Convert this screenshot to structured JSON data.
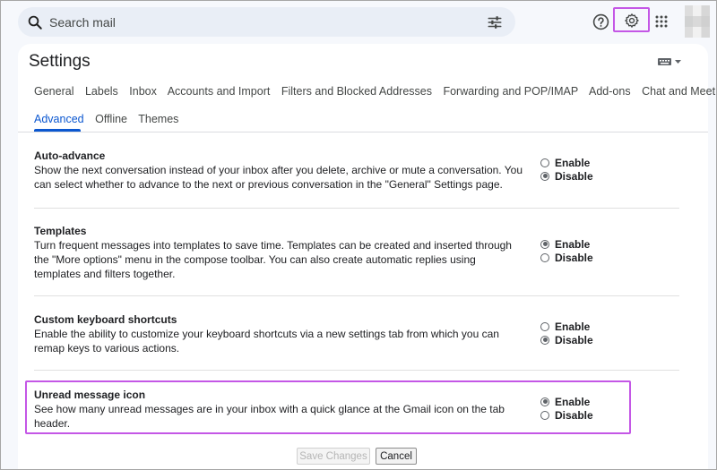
{
  "search": {
    "placeholder": "Search mail",
    "icon": "search-icon",
    "options_icon": "tune-icon"
  },
  "topbar": {
    "help_icon": "help-icon",
    "settings_icon": "gear-icon",
    "apps_icon": "apps-grid-icon",
    "highlight_color": "#c457e6"
  },
  "page": {
    "title": "Settings",
    "input_tools_icon": "keyboard-icon"
  },
  "tabs": {
    "row1": [
      "General",
      "Labels",
      "Inbox",
      "Accounts and Import",
      "Filters and Blocked Addresses",
      "Forwarding and POP/IMAP",
      "Add-ons",
      "Chat and Meet"
    ],
    "row2": [
      "Advanced",
      "Offline",
      "Themes"
    ],
    "active": "Advanced",
    "active_color": "#0b57d0"
  },
  "sections": [
    {
      "title": "Auto-advance",
      "lines": [
        "Show the next conversation instead of your inbox after you delete, archive or mute a conversation. You",
        "can select whether to advance to the next or previous conversation in the \"General\" Settings page."
      ],
      "options": [
        "Enable",
        "Disable"
      ],
      "selected": "Disable"
    },
    {
      "title": "Templates",
      "lines": [
        "Turn frequent messages into templates to save time. Templates can be created and inserted through",
        "the \"More options\" menu in the compose toolbar. You can also create automatic replies using",
        "templates and filters together."
      ],
      "options": [
        "Enable",
        "Disable"
      ],
      "selected": "Enable"
    },
    {
      "title": "Custom keyboard shortcuts",
      "lines": [
        "Enable the ability to customize your keyboard shortcuts via a new settings tab from which you can",
        "remap keys to various actions."
      ],
      "options": [
        "Enable",
        "Disable"
      ],
      "selected": "Disable"
    },
    {
      "title": "Unread message icon",
      "lines": [
        "See how many unread messages are in your inbox with a quick glance at the Gmail icon on the tab",
        "header."
      ],
      "options": [
        "Enable",
        "Disable"
      ],
      "selected": "Enable"
    }
  ],
  "buttons": {
    "save": "Save Changes",
    "cancel": "Cancel"
  }
}
